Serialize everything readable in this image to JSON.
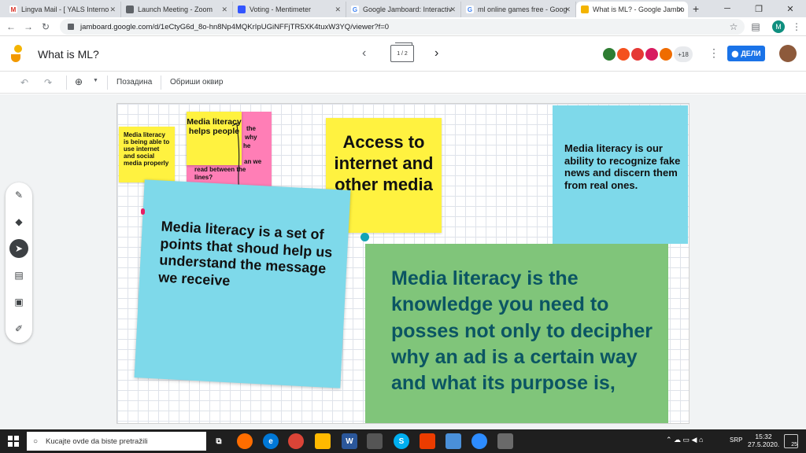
{
  "browser": {
    "tabs": [
      {
        "title": "Lingva Mail - [ YALS Interno",
        "icon": "gmail-icon",
        "color": "#d93025",
        "glyph": "M"
      },
      {
        "title": "Launch Meeting - Zoom",
        "icon": "globe-icon",
        "color": "#5f6368",
        "glyph": "◎"
      },
      {
        "title": "Voting - Mentimeter",
        "icon": "mentimeter-icon",
        "color": "#3355ff",
        "glyph": "▮"
      },
      {
        "title": "Google Jamboard: Interactiv",
        "icon": "google-icon",
        "color": "#4285f4",
        "glyph": "G"
      },
      {
        "title": "ml online games free - Goog",
        "icon": "google-icon",
        "color": "#4285f4",
        "glyph": "G"
      },
      {
        "title": "What is ML? - Google Jambo",
        "icon": "jamboard-icon",
        "color": "#f4b400",
        "glyph": "J"
      }
    ],
    "new_tab": "+",
    "url": "jamboard.google.com/d/1eCtyG6d_8o-hn8Np4MQKrIpUGiNFFjTR5XK4tuxW3YQ/viewer?f=0",
    "profile_initial": "M"
  },
  "jamboard": {
    "title": "What is ML?",
    "frame_indicator": "1 / 2",
    "collaborator_count": "+18",
    "share_label": "ДЕЛИ",
    "toolbar": {
      "background_label": "Позадина",
      "clear_label": "Обриши оквир"
    }
  },
  "notes": [
    {
      "text": "Media literacy is being able to use internet and social media properly",
      "color": "#fff240"
    },
    {
      "text": "the ... why the ... an we read between the lines?",
      "color": "#ff7eb6"
    },
    {
      "text": "Media literacy helps people",
      "color": "#fff240"
    },
    {
      "text": "Access to internet and other media",
      "color": "#fff240"
    },
    {
      "text": "Media literacy is our ability to recognize fake news and discern them from real ones.",
      "color": "#7ed9ea"
    },
    {
      "text": "Media literacy is a set of points that shoud help us understand the message we receive",
      "color": "#7ed9ea"
    },
    {
      "text": "Media literacy is the knowledge you need to posses not only to decipher why an ad is a certain way and what its purpose is,",
      "color": "#80c57a"
    }
  ],
  "pink_note_lines": [
    "the",
    "why",
    "he",
    "an we",
    "read between the",
    "lines?"
  ],
  "taskbar": {
    "search_placeholder": "Kucajte ovde da biste pretražili",
    "lang": "SRP",
    "time": "15:32",
    "date": "27.5.2020.",
    "notif_count": "25"
  }
}
